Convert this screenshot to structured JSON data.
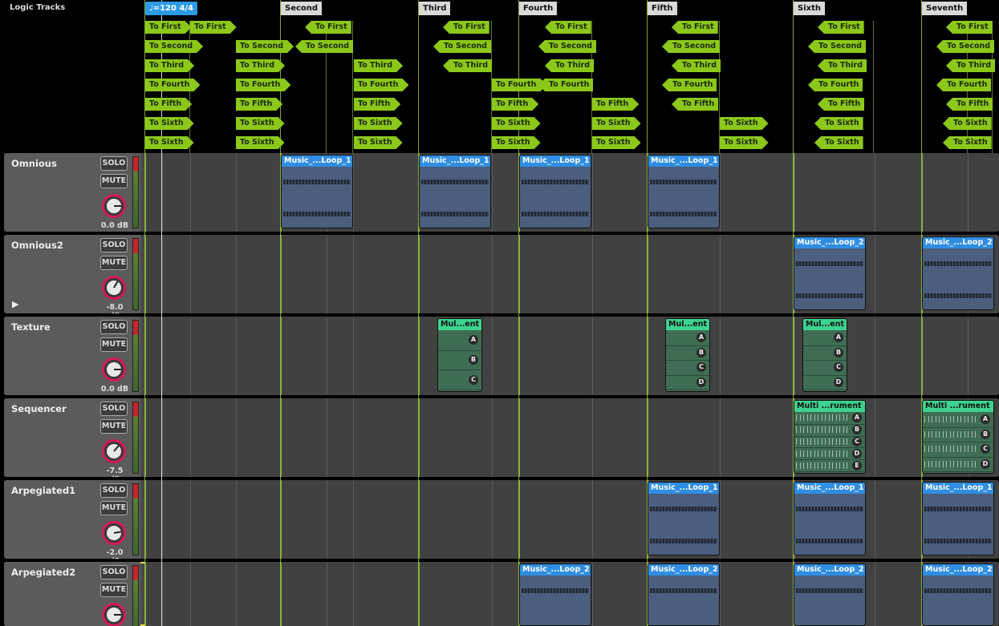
{
  "header": {
    "title": "Logic Tracks",
    "tempo": "♩=120 4/4",
    "sections": [
      "Second",
      "Third",
      "Fourth",
      "Fifth",
      "Sixth",
      "Seventh"
    ]
  },
  "logic_tags": {
    "first": "To First",
    "second": "To Second",
    "third": "To Third",
    "fourth": "To Fourth",
    "fifth": "To Fifth",
    "sixth": "To Sixth"
  },
  "buttons": {
    "solo": "SOLO",
    "mute": "MUTE"
  },
  "tracks": [
    {
      "name": "Omnious",
      "volume": "0.0 dB"
    },
    {
      "name": "Omnious2",
      "volume": "-8.0 dB"
    },
    {
      "name": "Texture",
      "volume": "0.0 dB"
    },
    {
      "name": "Sequencer",
      "volume": "-7.5 dB"
    },
    {
      "name": "Arpegiated1",
      "volume": "-2.0 dB"
    },
    {
      "name": "Arpegiated2",
      "volume": ""
    }
  ],
  "clip_labels": {
    "loop1": "Music_...Loop_1",
    "loop2": "Music_...Loop_2",
    "mul_short": "Mul...ent",
    "multi_long": "Multi ...rument"
  },
  "slot_letters": [
    "A",
    "B",
    "C",
    "D",
    "E"
  ],
  "colors": {
    "logic_tag": "#8cc81a",
    "audio_clip_header": "#2f8de3",
    "instrument_clip_header": "#3dd28f",
    "knob_ring": "#d4195a",
    "tempo_tag": "#2c9be5"
  }
}
